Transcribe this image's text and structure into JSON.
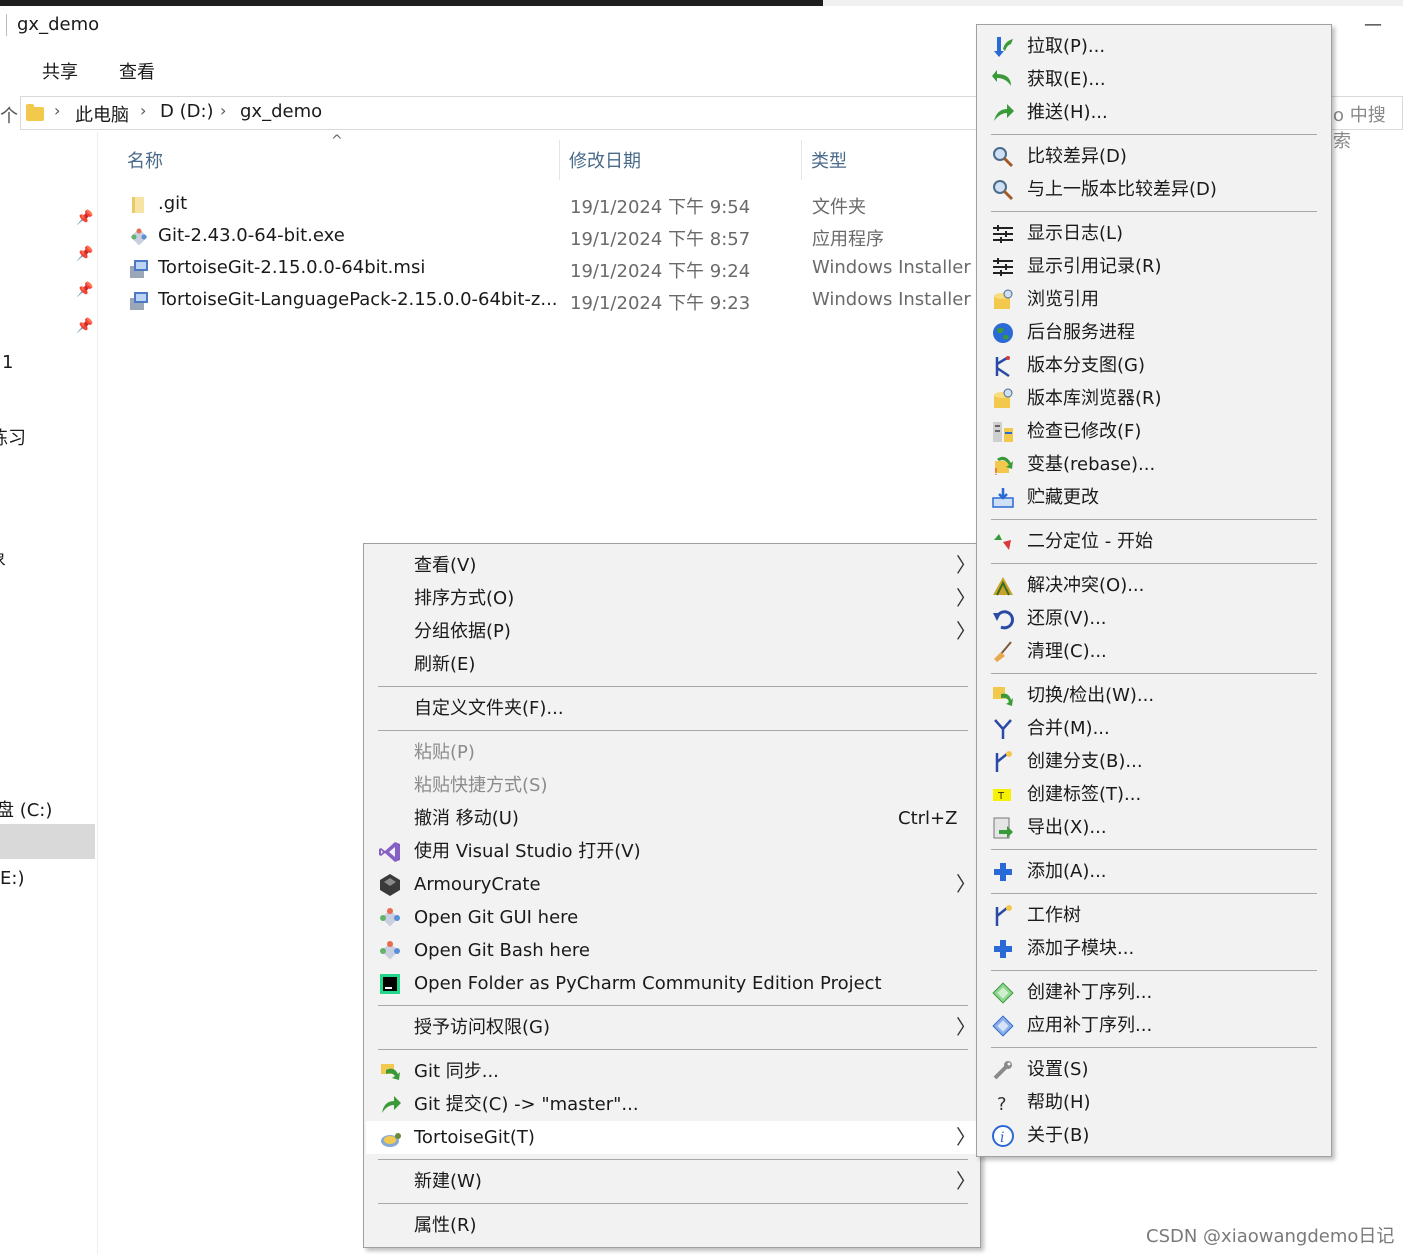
{
  "window": {
    "title": "gx_demo",
    "minimize_glyph": "—"
  },
  "ribbon": {
    "tabs": [
      "共享",
      "查看"
    ]
  },
  "address": {
    "back_glyph": "个",
    "breadcrumb": [
      "此电脑",
      "D (D:)",
      "gx_demo"
    ],
    "search_fragment": "o 中搜索"
  },
  "nav": {
    "items": [
      "1",
      "练习",
      "象",
      "盘 (C:)",
      "E:)"
    ]
  },
  "columns": {
    "name": "名称",
    "modified": "修改日期",
    "type": "类型"
  },
  "files": [
    {
      "name": ".git",
      "modified": "19/1/2024 下午 9:54",
      "type": "文件夹",
      "icon": "folder-icon"
    },
    {
      "name": "Git-2.43.0-64-bit.exe",
      "modified": "19/1/2024 下午 8:57",
      "type": "应用程序",
      "icon": "git-icon"
    },
    {
      "name": "TortoiseGit-2.15.0.0-64bit.msi",
      "modified": "19/1/2024 下午 9:24",
      "type": "Windows Installer ...",
      "icon": "installer-icon"
    },
    {
      "name": "TortoiseGit-LanguagePack-2.15.0.0-64bit-z...",
      "modified": "19/1/2024 下午 9:23",
      "type": "Windows Installer ...",
      "icon": "installer-icon"
    }
  ],
  "context_menu": {
    "items": [
      {
        "label": "查看(V)",
        "submenu": true
      },
      {
        "label": "排序方式(O)",
        "submenu": true
      },
      {
        "label": "分组依据(P)",
        "submenu": true
      },
      {
        "label": "刷新(E)"
      },
      {
        "label": "自定义文件夹(F)..."
      },
      {
        "label": "粘贴(P)",
        "disabled": true
      },
      {
        "label": "粘贴快捷方式(S)",
        "disabled": true
      },
      {
        "label": "撤消 移动(U)",
        "shortcut": "Ctrl+Z"
      },
      {
        "label": "使用 Visual Studio 打开(V)",
        "icon": "visual-studio-icon"
      },
      {
        "label": "ArmouryCrate",
        "icon": "armoury-crate-icon",
        "submenu": true
      },
      {
        "label": "Open Git GUI here",
        "icon": "git-gui-icon"
      },
      {
        "label": "Open Git Bash here",
        "icon": "git-bash-icon"
      },
      {
        "label": "Open Folder as PyCharm Community Edition Project",
        "icon": "pycharm-icon"
      },
      {
        "label": "授予访问权限(G)",
        "submenu": true
      },
      {
        "label": "Git 同步...",
        "icon": "git-sync-icon"
      },
      {
        "label": "Git 提交(C) -> \"master\"...",
        "icon": "git-commit-icon"
      },
      {
        "label": "TortoiseGit(T)",
        "icon": "tortoisegit-icon",
        "submenu": true,
        "highlighted": true
      },
      {
        "label": "新建(W)",
        "submenu": true
      },
      {
        "label": "属性(R)"
      }
    ]
  },
  "tortoise_menu": {
    "items": [
      {
        "label": "拉取(P)...",
        "icon": "pull-icon"
      },
      {
        "label": "获取(E)...",
        "icon": "fetch-icon"
      },
      {
        "label": "推送(H)...",
        "icon": "push-icon"
      },
      {
        "label": "比较差异(D)",
        "icon": "diff-icon"
      },
      {
        "label": "与上一版本比较差异(D)",
        "icon": "diff-previous-icon"
      },
      {
        "label": "显示日志(L)",
        "icon": "log-icon"
      },
      {
        "label": "显示引用记录(R)",
        "icon": "reflog-icon"
      },
      {
        "label": "浏览引用",
        "icon": "browse-refs-icon"
      },
      {
        "label": "后台服务进程",
        "icon": "daemon-icon"
      },
      {
        "label": "版本分支图(G)",
        "icon": "revision-graph-icon"
      },
      {
        "label": "版本库浏览器(R)",
        "icon": "repo-browser-icon"
      },
      {
        "label": "检查已修改(F)",
        "icon": "check-modifications-icon"
      },
      {
        "label": "变基(rebase)...",
        "icon": "rebase-icon"
      },
      {
        "label": "贮藏更改",
        "icon": "stash-icon"
      },
      {
        "label": "二分定位 - 开始",
        "icon": "bisect-icon"
      },
      {
        "label": "解决冲突(O)...",
        "icon": "resolve-icon"
      },
      {
        "label": "还原(V)...",
        "icon": "revert-icon"
      },
      {
        "label": "清理(C)...",
        "icon": "cleanup-icon"
      },
      {
        "label": "切换/检出(W)...",
        "icon": "switch-icon"
      },
      {
        "label": "合并(M)...",
        "icon": "merge-icon"
      },
      {
        "label": "创建分支(B)...",
        "icon": "branch-icon"
      },
      {
        "label": "创建标签(T)...",
        "icon": "tag-icon"
      },
      {
        "label": "导出(X)...",
        "icon": "export-icon"
      },
      {
        "label": "添加(A)...",
        "icon": "add-icon"
      },
      {
        "label": "工作树",
        "icon": "worktree-icon"
      },
      {
        "label": "添加子模块...",
        "icon": "add-submodule-icon"
      },
      {
        "label": "创建补丁序列...",
        "icon": "create-patch-icon"
      },
      {
        "label": "应用补丁序列...",
        "icon": "apply-patch-icon"
      },
      {
        "label": "设置(S)",
        "icon": "settings-icon"
      },
      {
        "label": "帮助(H)",
        "icon": "help-icon"
      },
      {
        "label": "关于(B)",
        "icon": "about-icon"
      }
    ]
  },
  "watermark": "CSDN @xiaowangdemo日记"
}
